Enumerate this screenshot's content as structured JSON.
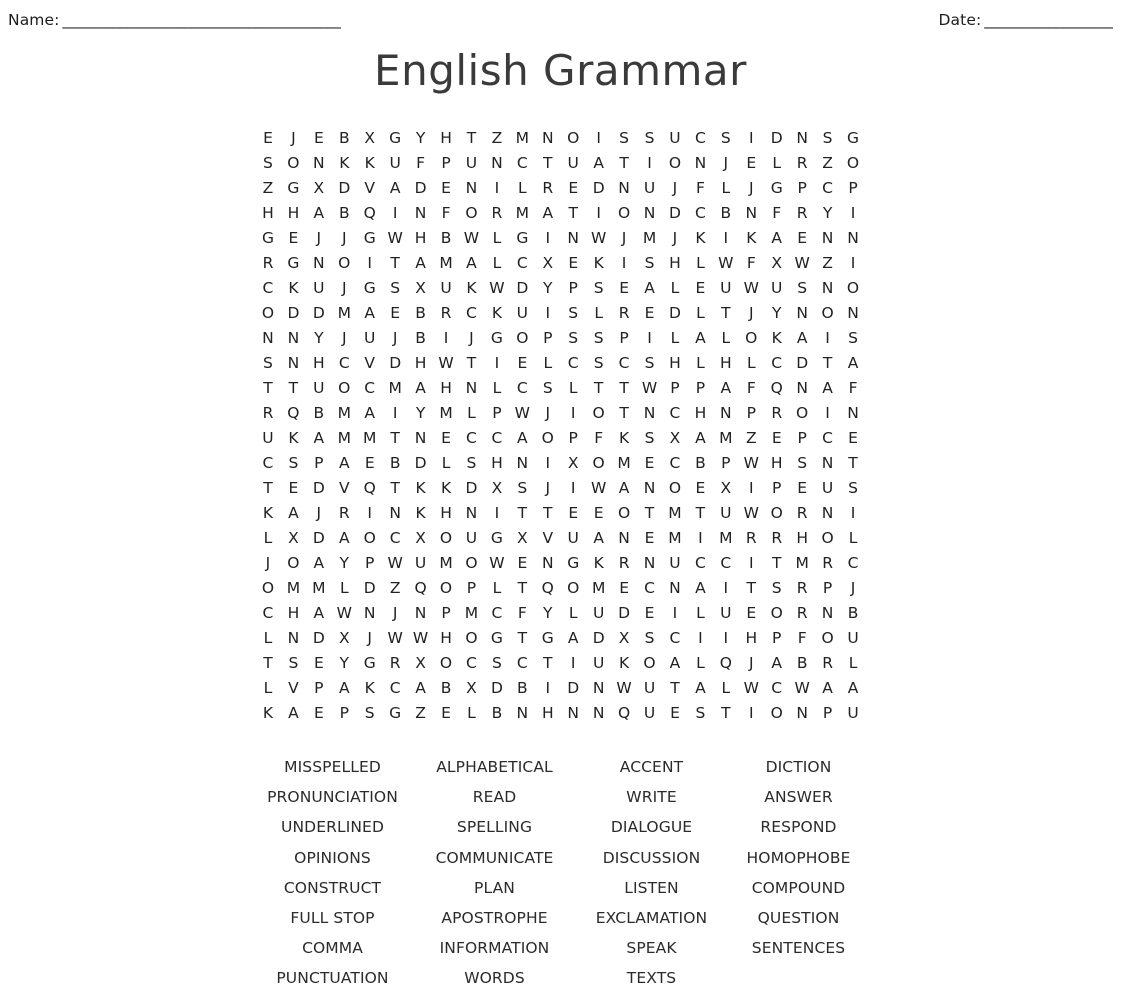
{
  "header": {
    "name_label": "Name:",
    "name_rule": "_______________________________________",
    "date_label": "Date:",
    "date_rule": "__________________"
  },
  "title": "English Grammar",
  "grid": {
    "rows": 24,
    "cols": 24,
    "letters": [
      "E J E B X G Y H T Z M N O I S S U C S I D N S G",
      "S O N K K U F P U N C T U A T I O N J E L R Z O",
      "Z G X D V A D E N I L R E D N U J F L J G P C P",
      "H H A B Q I N F O R M A T I O N D C B N F R Y I",
      "G E J J G W H B W L G I N W J M J K I K A E N N",
      "R G N O I T A M A L C X E K I S H L W F X W Z I",
      "C K U J G S X U K W D Y P S E A L E U W U S N O",
      "O D D M A E B R C K U I S L R E D L T J Y N O N",
      "N N Y J U J B I J G O P S S P I L A L O K A I S",
      "S N H C V D H W T I E L C S C S H L H L C D T A",
      "T T U O C M A H N L C S L T T W P P A F Q N A F",
      "R Q B M A I Y M L P W J I O T N C H N P R O I N",
      "U K A M M T N E C C A O P F K S X A M Z E P C E",
      "C S P A E B D L S H N I X O M E C B P W H S N T",
      "T E D V Q T K K D X S J I W A N O E X I P E U S",
      "K A J R I N K H N I T T E E O T M T U W O R N I",
      "L X D A O C X O U G X V U A N E M I M R R H O L",
      "J O A Y P W U M O W E N G K R N U C C I T M R C",
      "O M M L D Z Q O P L T Q O M E C N A I T S R P J",
      "C H A W N J N P M C F Y L U D E I L U E O R N B",
      "L N D X J W W H O G T G A D X S C I I H P F O U",
      "T S E Y G R X O C S C T I U K O A L Q J A B R L",
      "L V P A K C A B X D B I D N W U T A L W C W A A",
      "K A E P S G Z E L B N H N N Q U E S T I O N P U"
    ]
  },
  "word_list": {
    "columns": 4,
    "words": [
      "MISSPELLED",
      "ALPHABETICAL",
      "ACCENT",
      "DICTION",
      "PRONUNCIATION",
      "READ",
      "WRITE",
      "ANSWER",
      "UNDERLINED",
      "SPELLING",
      "DIALOGUE",
      "RESPOND",
      "OPINIONS",
      "COMMUNICATE",
      "DISCUSSION",
      "HOMOPHOBE",
      "CONSTRUCT",
      "PLAN",
      "LISTEN",
      "COMPOUND",
      "FULL STOP",
      "APOSTROPHE",
      "EXCLAMATION",
      "QUESTION",
      "COMMA",
      "INFORMATION",
      "SPEAK",
      "SENTENCES",
      "PUNCTUATION",
      "WORDS",
      "TEXTS",
      ""
    ]
  },
  "colors": {
    "text": "#2b2b2b",
    "title": "#3a3a3a",
    "background": "#ffffff"
  }
}
